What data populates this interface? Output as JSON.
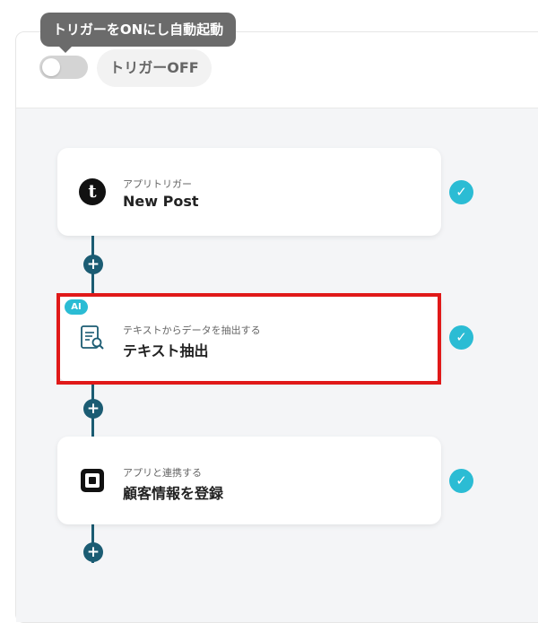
{
  "header": {
    "tooltip": "トリガーをONにし自動起動",
    "trigger_status": "トリガーOFF",
    "toggle_on": false
  },
  "steps": [
    {
      "subtitle": "アプリトリガー",
      "title": "New Post",
      "icon": "tumblr-icon",
      "icon_glyph": "t",
      "ai": false
    },
    {
      "subtitle": "テキストからデータを抽出する",
      "title": "テキスト抽出",
      "icon": "document-search-icon",
      "ai": true,
      "ai_label": "AI"
    },
    {
      "subtitle": "アプリと連携する",
      "title": "顧客情報を登録",
      "icon": "square-logo-icon",
      "ai": false
    }
  ],
  "colors": {
    "connector": "#1b5c73",
    "check": "#2bbcd4",
    "highlight": "#e01919",
    "canvas": "#f4f5f7"
  }
}
